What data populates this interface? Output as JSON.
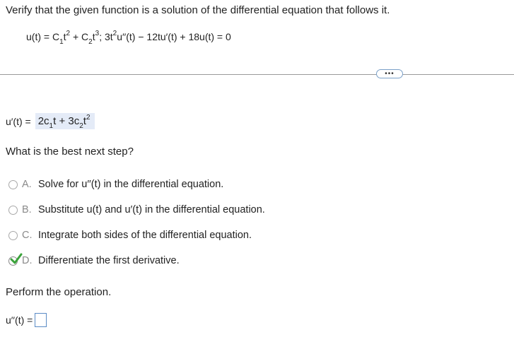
{
  "instruction": "Verify that the given function is a solution of the differential equation that follows it.",
  "equation": {
    "u_prefix": "u(t) = C",
    "c1_sub": "1",
    "t_1": "t",
    "exp2": "2",
    "plus_c": " + C",
    "c2_sub": "2",
    "t_2": "t",
    "exp3": "3",
    "sep": "; 3t",
    "exp2b": "2",
    "rest": "u′′(t) − 12tu′(t) + 18u(t) = 0"
  },
  "first_derivative": {
    "label": "u′(t) =",
    "ans_a": "2c",
    "ans_sub1": "1",
    "ans_b": "t + 3c",
    "ans_sub2": "2",
    "ans_c": "t",
    "ans_exp": "2"
  },
  "question": "What is the best next step?",
  "options": [
    {
      "letter": "A.",
      "text": "Solve for u′′(t) in the differential equation."
    },
    {
      "letter": "B.",
      "text": "Substitute u(t) and u′(t) in the differential equation."
    },
    {
      "letter": "C.",
      "text": "Integrate both sides of the differential equation."
    },
    {
      "letter": "D.",
      "text": "Differentiate the first derivative."
    }
  ],
  "selected_option": "D.",
  "more_button": "•••",
  "perform": "Perform the operation.",
  "answer": {
    "label": "u′′(t) =",
    "value": ""
  },
  "colors": {
    "check": "#3aa33a",
    "selected_bg": "#e4ebf7",
    "box_border": "#5a8bc5"
  }
}
